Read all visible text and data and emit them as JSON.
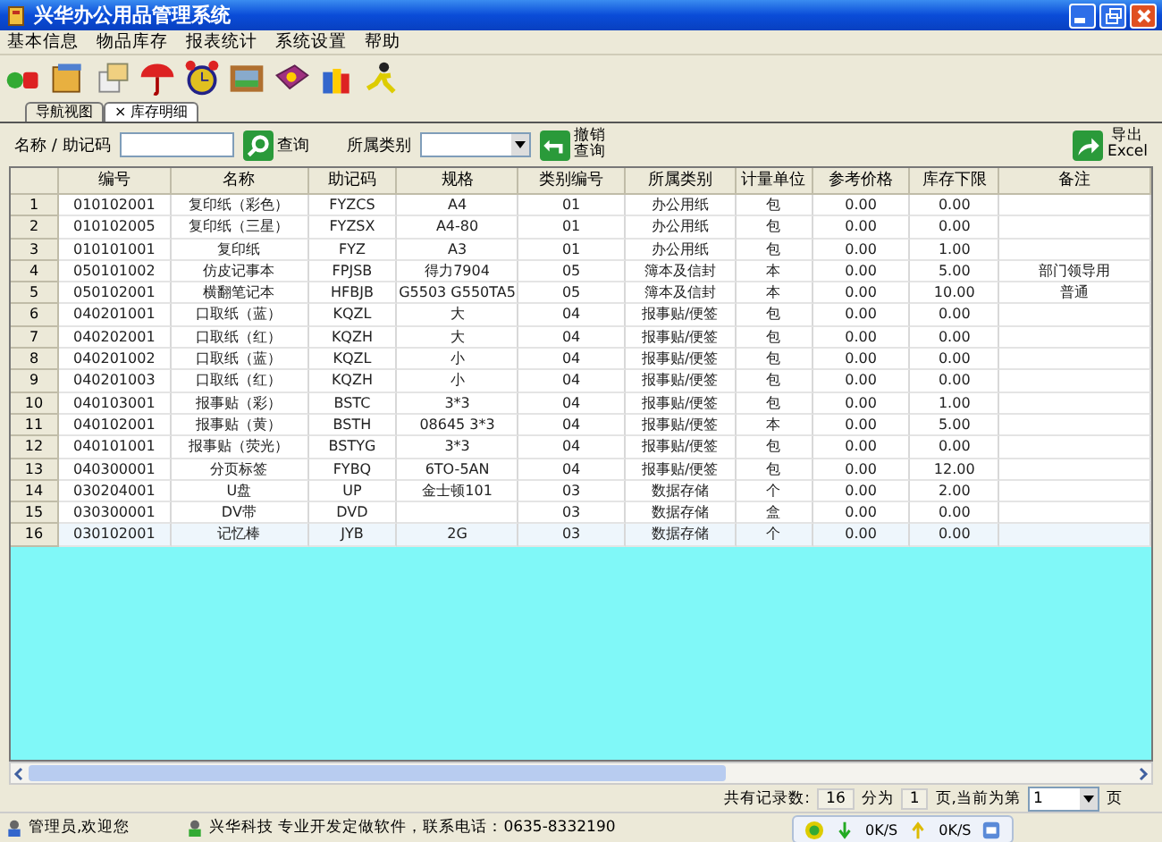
{
  "window": {
    "title": "兴华办公用品管理系统"
  },
  "menu": [
    "基本信息",
    "物品库存",
    "报表统计",
    "系统设置",
    "帮助"
  ],
  "tabs": [
    {
      "label": "导航视图",
      "selected": false
    },
    {
      "label": "× 库存明细",
      "selected": true
    }
  ],
  "search": {
    "name_label": "名称 / 助记码",
    "query_button": "查询",
    "category_label": "所属类别",
    "reset_button": [
      "撤销",
      "查询"
    ],
    "export_button": [
      "导出",
      "Excel"
    ]
  },
  "table": {
    "columns": [
      "编号",
      "名称",
      "助记码",
      "规格",
      "类别编号",
      "所属类别",
      "计量单位",
      "参考价格",
      "库存下限",
      "备注"
    ],
    "rows": [
      {
        "num": "1",
        "cells": [
          "010102001",
          "复印纸（彩色）",
          "FYZCS",
          "A4",
          "01",
          "办公用纸",
          "包",
          "0.00",
          "0.00",
          ""
        ],
        "selected": false
      },
      {
        "num": "2",
        "cells": [
          "010102005",
          "复印纸（三星）",
          "FYZSX",
          "A4-80",
          "01",
          "办公用纸",
          "包",
          "0.00",
          "0.00",
          ""
        ],
        "selected": false
      },
      {
        "num": "3",
        "cells": [
          "010101001",
          "复印纸",
          "FYZ",
          "A3",
          "01",
          "办公用纸",
          "包",
          "0.00",
          "1.00",
          ""
        ],
        "selected": false
      },
      {
        "num": "4",
        "cells": [
          "050101002",
          "仿皮记事本",
          "FPJSB",
          "得力7904",
          "05",
          "簿本及信封",
          "本",
          "0.00",
          "5.00",
          "部门领导用"
        ],
        "selected": false
      },
      {
        "num": "5",
        "cells": [
          "050102001",
          "横翻笔记本",
          "HFBJB",
          "G5503 G550TA5",
          "05",
          "簿本及信封",
          "本",
          "0.00",
          "10.00",
          "普通"
        ],
        "selected": false
      },
      {
        "num": "6",
        "cells": [
          "040201001",
          "口取纸（蓝）",
          "KQZL",
          "大",
          "04",
          "报事贴/便签",
          "包",
          "0.00",
          "0.00",
          ""
        ],
        "selected": false
      },
      {
        "num": "7",
        "cells": [
          "040202001",
          "口取纸（红）",
          "KQZH",
          "大",
          "04",
          "报事贴/便签",
          "包",
          "0.00",
          "0.00",
          ""
        ],
        "selected": false
      },
      {
        "num": "8",
        "cells": [
          "040201002",
          "口取纸（蓝）",
          "KQZL",
          "小",
          "04",
          "报事贴/便签",
          "包",
          "0.00",
          "0.00",
          ""
        ],
        "selected": false
      },
      {
        "num": "9",
        "cells": [
          "040201003",
          "口取纸（红）",
          "KQZH",
          "小",
          "04",
          "报事贴/便签",
          "包",
          "0.00",
          "0.00",
          ""
        ],
        "selected": false
      },
      {
        "num": "10",
        "cells": [
          "040103001",
          "报事贴（彩）",
          "BSTC",
          "3*3",
          "04",
          "报事贴/便签",
          "包",
          "0.00",
          "1.00",
          ""
        ],
        "selected": false
      },
      {
        "num": "11",
        "cells": [
          "040102001",
          "报事贴（黄）",
          "BSTH",
          "08645 3*3",
          "04",
          "报事贴/便签",
          "本",
          "0.00",
          "5.00",
          ""
        ],
        "selected": false
      },
      {
        "num": "12",
        "cells": [
          "040101001",
          "报事贴（荧光）",
          "BSTYG",
          "3*3",
          "04",
          "报事贴/便签",
          "包",
          "0.00",
          "0.00",
          ""
        ],
        "selected": false
      },
      {
        "num": "13",
        "cells": [
          "040300001",
          "分页标签",
          "FYBQ",
          "6TO-5AN",
          "04",
          "报事贴/便签",
          "包",
          "0.00",
          "12.00",
          ""
        ],
        "selected": false
      },
      {
        "num": "14",
        "cells": [
          "030204001",
          "U盘",
          "UP",
          "金士顿101",
          "03",
          "数据存储",
          "个",
          "0.00",
          "2.00",
          ""
        ],
        "selected": false
      },
      {
        "num": "15",
        "cells": [
          "030300001",
          "DV带",
          "DVD",
          "",
          "03",
          "数据存储",
          "盒",
          "0.00",
          "0.00",
          ""
        ],
        "selected": false
      },
      {
        "num": "16",
        "cells": [
          "030102001",
          "记忆棒",
          "JYB",
          "2G",
          "03",
          "数据存储",
          "个",
          "0.00",
          "0.00",
          ""
        ],
        "selected": true
      }
    ]
  },
  "pager": {
    "total_label": "共有记录数:",
    "total": "16",
    "pages_label": "分为",
    "pages": "1",
    "current_label": "页,当前为第",
    "current": "1",
    "page_unit": "页"
  },
  "status_bar": {
    "user": "管理员,欢迎您",
    "company": "兴华科技 专业开发定做软件，联系电话：0635-8332190"
  },
  "network": {
    "down": "0K/S",
    "up": "0K/S"
  }
}
